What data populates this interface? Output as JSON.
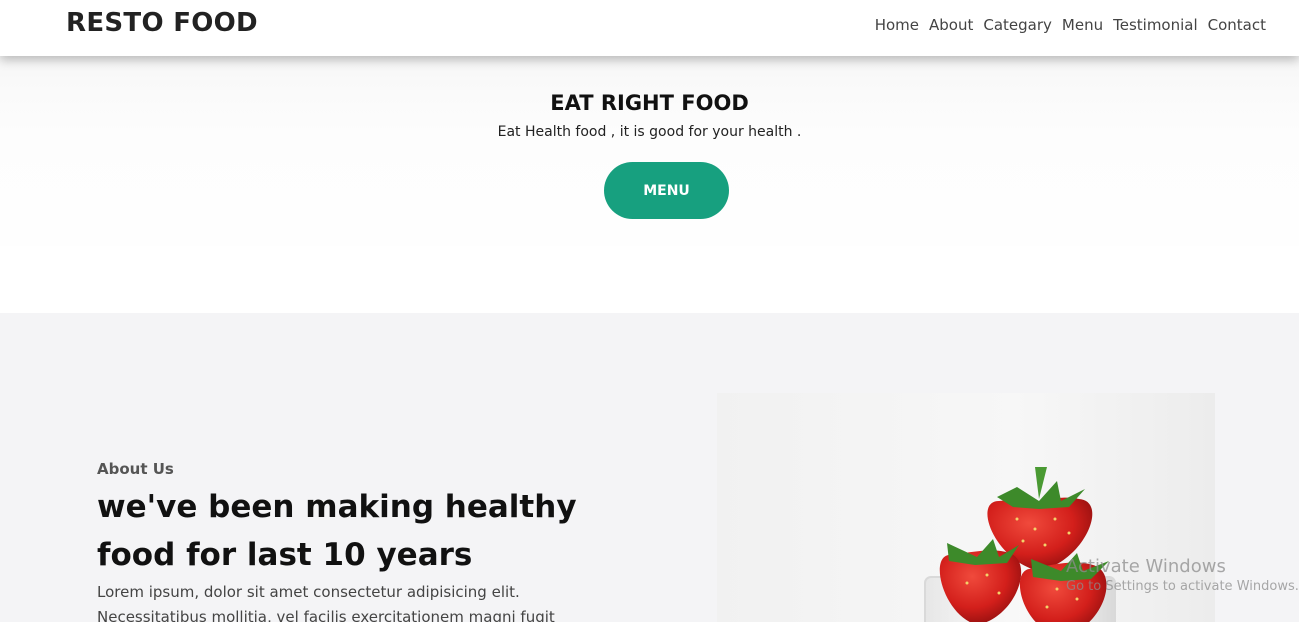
{
  "brand": "RESTO FOOD",
  "nav": {
    "items": [
      "Home",
      "About",
      "Categary",
      "Menu",
      "Testimonial",
      "Contact"
    ]
  },
  "hero": {
    "title": "EAT RIGHT FOOD",
    "subtitle": "Eat Health food , it is good for your health .",
    "button_label": "MENU"
  },
  "about": {
    "label": "About Us",
    "heading": "we've been making healthy food for last 10 years",
    "text": "Lorem ipsum, dolor sit amet consectetur adipisicing elit. Necessitatibus mollitia, vel facilis exercitationem magni fugit"
  },
  "watermark": {
    "title": "Activate Windows",
    "subtitle": "Go to Settings to activate Windows."
  },
  "colors": {
    "accent": "#17a07f",
    "about_bg": "#f4f4f6"
  },
  "icons": {
    "about_image": "strawberries-in-glass-image"
  }
}
